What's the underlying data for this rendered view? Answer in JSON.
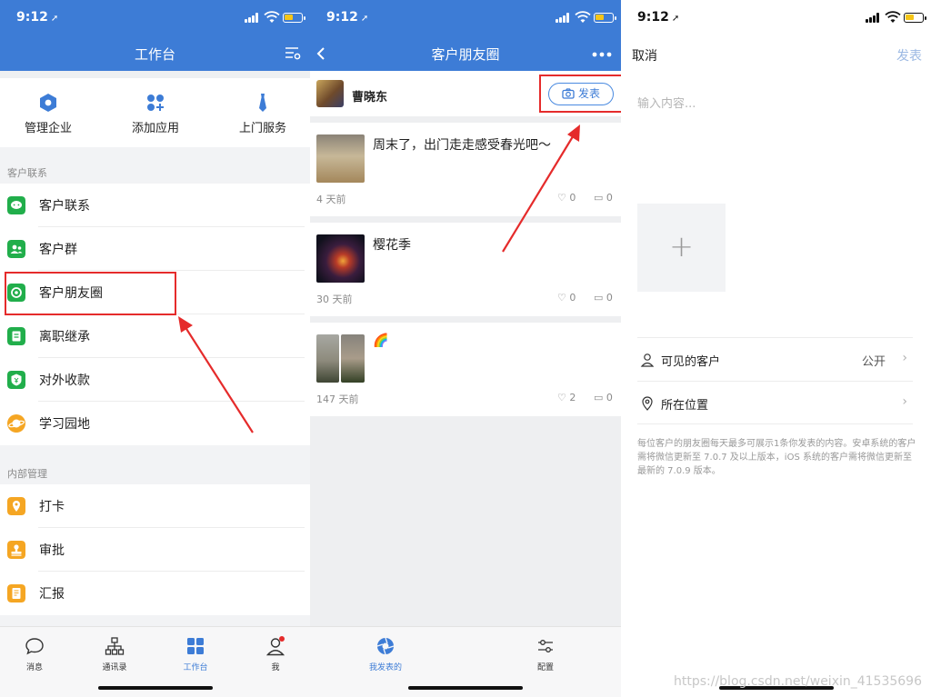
{
  "colors": {
    "brand_blue": "#3d7cd6",
    "alert_red": "#e52b2b",
    "green": "#21ae4b",
    "orange": "#f5a623"
  },
  "status": {
    "time": "9:12"
  },
  "workbench": {
    "title": "工作台",
    "quick_actions": [
      {
        "label": "管理企业",
        "icon": "hexagon-icon"
      },
      {
        "label": "添加应用",
        "icon": "add-app-icon"
      },
      {
        "label": "上门服务",
        "icon": "tie-icon"
      }
    ],
    "section_customer": "客户联系",
    "customer_items": [
      {
        "label": "客户联系",
        "icon": "chat-icon"
      },
      {
        "label": "客户群",
        "icon": "group-icon"
      },
      {
        "label": "客户朋友圈",
        "icon": "moments-icon"
      },
      {
        "label": "离职继承",
        "icon": "document-icon"
      },
      {
        "label": "对外收款",
        "icon": "payment-icon"
      },
      {
        "label": "学习园地",
        "icon": "planet-icon"
      }
    ],
    "section_internal": "内部管理",
    "internal_items": [
      {
        "label": "打卡",
        "icon": "checkin-icon"
      },
      {
        "label": "审批",
        "icon": "approval-icon"
      },
      {
        "label": "汇报",
        "icon": "report-icon"
      }
    ],
    "tabs": [
      "消息",
      "通讯录",
      "工作台",
      "我"
    ]
  },
  "moments": {
    "title": "客户朋友圈",
    "user": "曹晓东",
    "post_button": "发表",
    "posts": [
      {
        "text": "周末了，出门走走感受春光吧～",
        "date": "4 天前",
        "likes": "0",
        "comments": "0"
      },
      {
        "text": "樱花季",
        "date": "30 天前",
        "likes": "0",
        "comments": "0"
      },
      {
        "text": "🌈",
        "date": "147 天前",
        "likes": "2",
        "comments": "0"
      }
    ],
    "tabs": [
      "我发表的",
      "配置"
    ]
  },
  "compose": {
    "cancel": "取消",
    "publish": "发表",
    "placeholder": "输入内容...",
    "add": "+",
    "visible_label": "可见的客户",
    "visible_value": "公开",
    "location_label": "所在位置",
    "note": "每位客户的朋友圈每天最多可展示1条你发表的内容。安卓系统的客户需将微信更新至 7.0.7 及以上版本，iOS 系统的客户需将微信更新至最新的 7.0.9 版本。",
    "watermark": "https://blog.csdn.net/weixin_41535696"
  }
}
